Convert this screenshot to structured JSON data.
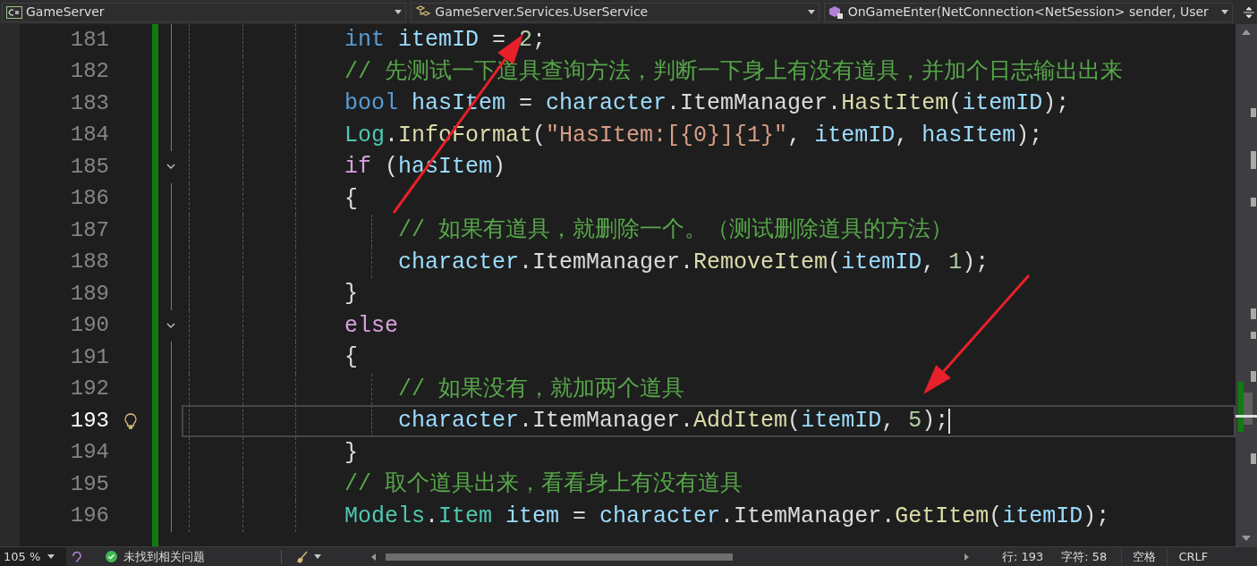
{
  "nav_bar": {
    "project": "GameServer",
    "class": "GameServer.Services.UserService",
    "member": "OnGameEnter(NetConnection<NetSession> sender, User"
  },
  "editor": {
    "lines": [
      {
        "number": "181",
        "current": false,
        "fold": false,
        "lightbulb": false,
        "inner": false,
        "tokens": [
          {
            "kind": "keyword",
            "text": "int"
          },
          {
            "kind": "variable",
            "text": " itemID"
          },
          {
            "kind": "plain",
            "text": " = "
          },
          {
            "kind": "number",
            "text": "2"
          },
          {
            "kind": "plain",
            "text": ";"
          }
        ]
      },
      {
        "number": "182",
        "current": false,
        "fold": false,
        "lightbulb": false,
        "inner": false,
        "tokens": [
          {
            "kind": "comment",
            "text": "// 先测试一下道具查询方法，判断一下身上有没有道具，并加个日志输出出来"
          }
        ]
      },
      {
        "number": "183",
        "current": false,
        "fold": false,
        "lightbulb": false,
        "inner": false,
        "tokens": [
          {
            "kind": "keyword",
            "text": "bool"
          },
          {
            "kind": "variable",
            "text": " hasItem"
          },
          {
            "kind": "plain",
            "text": " = "
          },
          {
            "kind": "variable",
            "text": "character"
          },
          {
            "kind": "plain",
            "text": ".ItemManager."
          },
          {
            "kind": "method",
            "text": "HastItem"
          },
          {
            "kind": "plain",
            "text": "("
          },
          {
            "kind": "variable",
            "text": "itemID"
          },
          {
            "kind": "plain",
            "text": ");"
          }
        ]
      },
      {
        "number": "184",
        "current": false,
        "fold": false,
        "lightbulb": false,
        "inner": false,
        "tokens": [
          {
            "kind": "type",
            "text": "Log"
          },
          {
            "kind": "plain",
            "text": "."
          },
          {
            "kind": "method",
            "text": "InfoFormat"
          },
          {
            "kind": "plain",
            "text": "("
          },
          {
            "kind": "string",
            "text": "\"HasItem:[{0}]{1}\""
          },
          {
            "kind": "plain",
            "text": ", "
          },
          {
            "kind": "variable",
            "text": "itemID"
          },
          {
            "kind": "plain",
            "text": ", "
          },
          {
            "kind": "variable",
            "text": "hasItem"
          },
          {
            "kind": "plain",
            "text": ");"
          }
        ]
      },
      {
        "number": "185",
        "current": false,
        "fold": true,
        "lightbulb": false,
        "inner": false,
        "tokens": [
          {
            "kind": "control",
            "text": "if"
          },
          {
            "kind": "plain",
            "text": " ("
          },
          {
            "kind": "variable",
            "text": "hasItem"
          },
          {
            "kind": "plain",
            "text": ")"
          }
        ]
      },
      {
        "number": "186",
        "current": false,
        "fold": false,
        "lightbulb": false,
        "inner": false,
        "tokens": [
          {
            "kind": "plain",
            "text": "{"
          }
        ]
      },
      {
        "number": "187",
        "current": false,
        "fold": false,
        "lightbulb": false,
        "inner": true,
        "tokens": [
          {
            "kind": "comment",
            "text": "// 如果有道具，就删除一个。（测试删除道具的方法）"
          }
        ]
      },
      {
        "number": "188",
        "current": false,
        "fold": false,
        "lightbulb": false,
        "inner": true,
        "tokens": [
          {
            "kind": "variable",
            "text": "character"
          },
          {
            "kind": "plain",
            "text": ".ItemManager."
          },
          {
            "kind": "method",
            "text": "RemoveItem"
          },
          {
            "kind": "plain",
            "text": "("
          },
          {
            "kind": "variable",
            "text": "itemID"
          },
          {
            "kind": "plain",
            "text": ", "
          },
          {
            "kind": "number",
            "text": "1"
          },
          {
            "kind": "plain",
            "text": ");"
          }
        ]
      },
      {
        "number": "189",
        "current": false,
        "fold": false,
        "lightbulb": false,
        "inner": false,
        "tokens": [
          {
            "kind": "plain",
            "text": "}"
          }
        ]
      },
      {
        "number": "190",
        "current": false,
        "fold": true,
        "lightbulb": false,
        "inner": false,
        "tokens": [
          {
            "kind": "control",
            "text": "else"
          }
        ]
      },
      {
        "number": "191",
        "current": false,
        "fold": false,
        "lightbulb": false,
        "inner": false,
        "tokens": [
          {
            "kind": "plain",
            "text": "{"
          }
        ]
      },
      {
        "number": "192",
        "current": false,
        "fold": false,
        "lightbulb": false,
        "inner": true,
        "tokens": [
          {
            "kind": "comment",
            "text": "// 如果没有，就加两个道具"
          }
        ]
      },
      {
        "number": "193",
        "current": true,
        "fold": false,
        "lightbulb": true,
        "inner": true,
        "tokens": [
          {
            "kind": "variable",
            "text": "character"
          },
          {
            "kind": "plain",
            "text": ".ItemManager."
          },
          {
            "kind": "method",
            "text": "AddItem"
          },
          {
            "kind": "plain",
            "text": "("
          },
          {
            "kind": "variable",
            "text": "itemID"
          },
          {
            "kind": "plain",
            "text": ", "
          },
          {
            "kind": "number",
            "text": "5"
          },
          {
            "kind": "plain",
            "text": ");"
          }
        ]
      },
      {
        "number": "194",
        "current": false,
        "fold": false,
        "lightbulb": false,
        "inner": false,
        "tokens": [
          {
            "kind": "plain",
            "text": "}"
          }
        ]
      },
      {
        "number": "195",
        "current": false,
        "fold": false,
        "lightbulb": false,
        "inner": false,
        "tokens": [
          {
            "kind": "comment",
            "text": "// 取个道具出来，看看身上有没有道具"
          }
        ]
      },
      {
        "number": "196",
        "current": false,
        "fold": false,
        "lightbulb": false,
        "inner": false,
        "tokens": [
          {
            "kind": "type",
            "text": "Models"
          },
          {
            "kind": "plain",
            "text": "."
          },
          {
            "kind": "type",
            "text": "Item"
          },
          {
            "kind": "variable",
            "text": " item"
          },
          {
            "kind": "plain",
            "text": " = "
          },
          {
            "kind": "variable",
            "text": "character"
          },
          {
            "kind": "plain",
            "text": ".ItemManager."
          },
          {
            "kind": "method",
            "text": "GetItem"
          },
          {
            "kind": "plain",
            "text": "("
          },
          {
            "kind": "variable",
            "text": "itemID"
          },
          {
            "kind": "plain",
            "text": ");"
          }
        ]
      }
    ]
  },
  "status_bar": {
    "zoom": "105 %",
    "issues": "未找到相关问题",
    "line": "行: 193",
    "column": "字符: 58",
    "whitespace": "空格",
    "line_ending": "CRLF"
  }
}
